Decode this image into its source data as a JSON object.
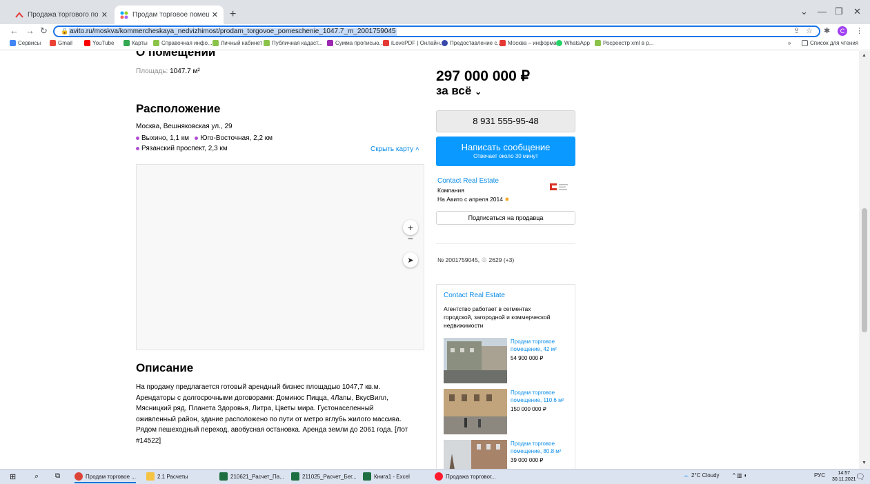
{
  "browser": {
    "tabs": [
      {
        "title": "Продажа торгового помещени"
      },
      {
        "title": "Продам торговое помещение,"
      }
    ],
    "new_tab": "+",
    "url": "avito.ru/moskva/kommercheskaya_nedvizhimost/prodam_torgovoe_pomeschenie_1047.7_m_2001759045",
    "profile_initial": "C",
    "bookmarks": [
      {
        "label": "Сервисы",
        "color": "#4285f4"
      },
      {
        "label": "Gmail",
        "color": "#ea4335"
      },
      {
        "label": "YouTube",
        "color": "#ff0000"
      },
      {
        "label": "Карты",
        "color": "#34a853"
      },
      {
        "label": "Справочная инфо...",
        "color": "#8bc34a"
      },
      {
        "label": "Личный кабинет",
        "color": "#8bc34a"
      },
      {
        "label": "Публичная кадаст...",
        "color": "#8bc34a"
      },
      {
        "label": "Сумма прописью...",
        "color": "#9c27b0"
      },
      {
        "label": "iLovePDF | Онлайн...",
        "color": "#e53935"
      },
      {
        "label": "Предоставление с...",
        "color": "#3949ab"
      },
      {
        "label": "Москва – информа...",
        "color": "#e53935"
      },
      {
        "label": "WhatsApp",
        "color": "#25d366"
      },
      {
        "label": "Росреестр xml в р...",
        "color": "#8bc34a"
      }
    ],
    "bookmarks_more": "»",
    "reading_list": "Список для чтения"
  },
  "listing": {
    "section_about_heading": "О помещении",
    "area_label": "Площадь:",
    "area_value": "1047.7 м²",
    "location_heading": "Расположение",
    "address": "Москва, Вешняковская ул., 29",
    "metro": [
      {
        "name": "Выхино",
        "distance": "1,1 км"
      },
      {
        "name": "Юго-Восточная",
        "distance": "2,2 км"
      },
      {
        "name": "Рязанский проспект",
        "distance": "2,3 км"
      }
    ],
    "hide_map": "Скрыть карту",
    "description_heading": "Описание",
    "description_lines": [
      "На продажу предлагается готовый арендный бизнес площадью 1047,7 кв.м.",
      "Арендаторы с долгосрочными договорами: Доминос Пицца, 4Лапы, ВкусВилл,",
      "Мясницкий ряд, Планета Здоровья, Литра, Цветы мира. Густонаселенный",
      "оживленный район, здание расположено по пути от метро вглубь жилого массива.",
      "Рядом пешеходный переход, авобусная остановка. Аренда земли до 2061 года. [Лот",
      "#14522]"
    ]
  },
  "sidebar": {
    "price": "297 000 000 ₽",
    "price_mode": "за всё",
    "phone": "8 931 555-95-48",
    "message_button": "Написать сообщение",
    "message_sub": "Отвечает около 30 минут",
    "seller_name": "Contact Real Estate",
    "seller_type": "Компания",
    "seller_since": "На Авито с апреля 2014",
    "subscribe": "Подписаться на продавца",
    "ad_number": "№ 2001759045,",
    "views": "2629 (+3)",
    "agency_name": "Contact Real Estate",
    "agency_desc_lines": [
      "Агентство работает в сегментах",
      "городской, загородной и коммерческой",
      "недвижимости"
    ],
    "other_listings": [
      {
        "title_lines": [
          "Продам торговое",
          "помещение, 42 м²"
        ],
        "price": "54 900 000 ₽"
      },
      {
        "title_lines": [
          "Продам торговое",
          "помещение, 110.6 м²"
        ],
        "price": "150 000 000 ₽"
      },
      {
        "title_lines": [
          "Продам торговое",
          "помещение, 80.8 м²"
        ],
        "price": "39 000 000 ₽"
      }
    ]
  },
  "taskbar": {
    "apps": [
      {
        "label": "Продам торговое ..."
      },
      {
        "label": "2.1 Расчеты"
      },
      {
        "label": "210621_Расчет_Па..."
      },
      {
        "label": "211025_Расчет_Бег..."
      },
      {
        "label": "Книга1 - Excel"
      },
      {
        "label": "Продажа торговог..."
      }
    ],
    "weather": "2°C Cloudy",
    "lang": "РУС",
    "time": "14:57",
    "date": "30.11.2021"
  }
}
